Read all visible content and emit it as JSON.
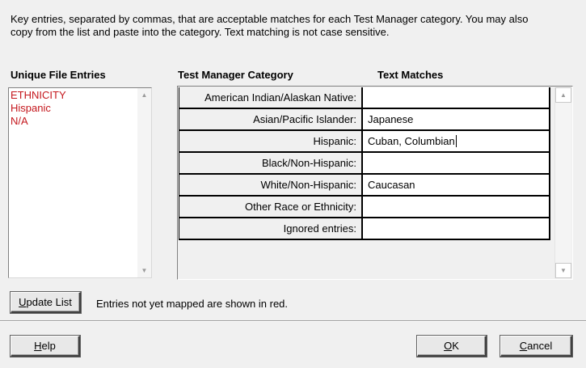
{
  "instructions": {
    "line1": "Key entries, separated by commas, that are acceptable matches for each Test Manager category.  You may also",
    "line2": "copy from the list and paste into the category.  Text matching is not case sensitive."
  },
  "headers": {
    "unique_file_entries": "Unique File Entries",
    "test_manager_category": "Test Manager Category",
    "text_matches": "Text Matches"
  },
  "unique_entries": [
    {
      "label": "ETHNICITY",
      "color": "#c4161c"
    },
    {
      "label": "Hispanic",
      "color": "#c4161c"
    },
    {
      "label": "N/A",
      "color": "#c4161c"
    }
  ],
  "categories": [
    {
      "category": "American Indian/Alaskan Native:",
      "matches": ""
    },
    {
      "category": "Asian/Pacific Islander:",
      "matches": "Japanese"
    },
    {
      "category": "Hispanic:",
      "matches": "Cuban, Columbian"
    },
    {
      "category": "Black/Non-Hispanic:",
      "matches": ""
    },
    {
      "category": "White/Non-Hispanic:",
      "matches": "Caucasan"
    },
    {
      "category": "Other Race or Ethnicity:",
      "matches": ""
    },
    {
      "category": "Ignored entries:",
      "matches": ""
    }
  ],
  "buttons": {
    "update_list": {
      "pre": "",
      "mnemonic": "U",
      "post": "pdate List"
    },
    "help": {
      "pre": "",
      "mnemonic": "H",
      "post": "elp"
    },
    "ok": {
      "pre": "",
      "mnemonic": "O",
      "post": "K"
    },
    "cancel": {
      "pre": "",
      "mnemonic": "C",
      "post": "ancel"
    }
  },
  "note": "Entries not yet mapped are shown in red.",
  "icons": {
    "scroll_up": "triangle-up",
    "scroll_down": "triangle-down"
  },
  "colors": {
    "unmapped_entry": "#c4161c"
  }
}
